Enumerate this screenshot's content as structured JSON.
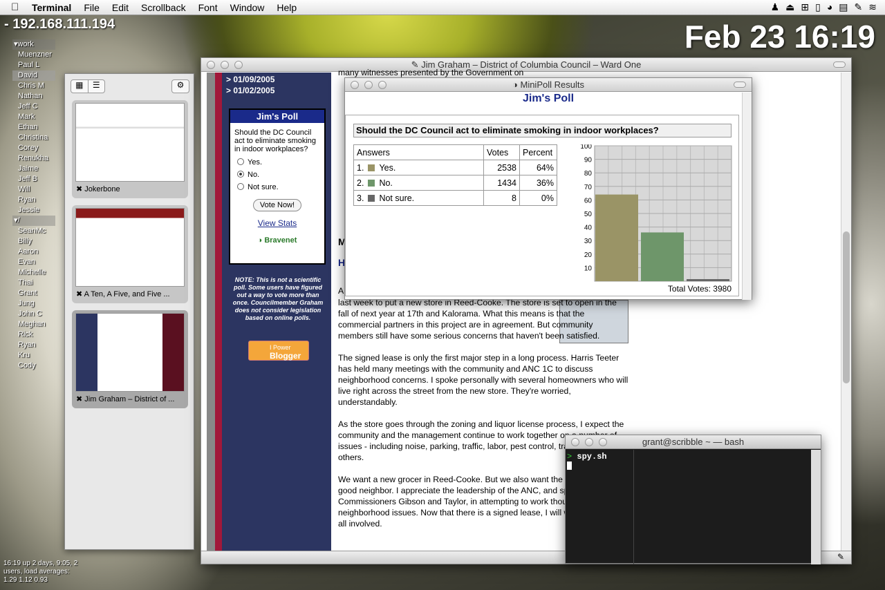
{
  "menubar": {
    "app": "Terminal",
    "items": [
      "File",
      "Edit",
      "Scrollback",
      "Font",
      "Window",
      "Help"
    ]
  },
  "desktop": {
    "ip": "- 192.168.111.194",
    "clock": "Feb 23 16:19",
    "uptime": [
      "16:19  up 2 days,  9:05, 2",
      "users, load averages:",
      "1.29 1.12 0.93"
    ]
  },
  "buddies": {
    "groups": [
      {
        "name": "▾work",
        "items": [
          "Muenzner",
          "Paul L",
          "David",
          "Chris M",
          "Nathan",
          "Jeff C",
          "Mark",
          "Ethan",
          "Christina",
          "Corey",
          "Renukha",
          "Jaime",
          "Jeff B",
          "Will",
          "Ryan",
          "Jessie"
        ]
      },
      {
        "name": "▾/",
        "items": [
          "SeanMc",
          "Billy",
          "Aaron",
          "Evan",
          "Michelle",
          "Thai",
          "Grant",
          "Jung",
          "John C",
          "Meghan",
          "Rick",
          "Ryan",
          "Kru",
          "Cody"
        ]
      }
    ]
  },
  "drawer": {
    "tabs": [
      {
        "title": "Jokerbone"
      },
      {
        "title": "A Ten, A Five, and Five ..."
      },
      {
        "title": "Jim Graham – District of ..."
      }
    ]
  },
  "browser": {
    "title": "Jim Graham – District of Columbia Council – Ward One",
    "dates": [
      "> 01/09/2005",
      "> 01/02/2005"
    ],
    "poll": {
      "title": "Jim's Poll",
      "question": "Should the DC Council act to eliminate smoking in indoor workplaces?",
      "options": [
        "Yes.",
        "No.",
        "Not sure."
      ],
      "vote": "Vote Now!",
      "stats": "View Stats",
      "brand": "Bravenet"
    },
    "note": "NOTE: This is not a scientific poll. Some users have figured out a way to vote more than once. Councilmember Graham does not consider legislation based on online polls.",
    "blogger": {
      "small": "I Power",
      "big": "Blogger"
    },
    "partial": {
      "top": "many witnesses presented by the Government on",
      "m": "M",
      "h": "H",
      "a": "A"
    },
    "article": [
      "last week to put a new store in Reed-Cooke. The store is set to open in the fall of next year at 17th and Kalorama. What this means is that the commercial partners in this project are in agreement. But community members still have some serious concerns that haven't been satisfied.",
      "The signed lease is only the first major step in a long process. Harris Teeter has held many meetings with the community and ANC 1C to discuss neighborhood concerns. I spoke personally with several homeowners who will live right across the street from the new store. They're worried, understandably.",
      "As the store goes through the zoning and liquor license process, I expect the community and the management continue to work together on a number of issues - including noise, parking, traffic, labor, pest control, trash, lighting and others.",
      "We want a new grocer in Reed-Cooke. But we also want the store to be a good neighbor. I appreciate the leadership of the ANC, and specifically Commissioners Gibson and Taylor, in attempting to work though these neighborhood issues. Now that there is a signed lease, I will work closely with all involved."
    ]
  },
  "minipoll": {
    "window_title": "MiniPoll Results",
    "title": "Jim's Poll",
    "question": "Should the DC Council act to eliminate smoking in indoor workplaces?",
    "headers": [
      "Answers",
      "Votes",
      "Percent"
    ],
    "rows": [
      {
        "num": "1.",
        "label": "Yes.",
        "votes": "2538",
        "pct": "64%",
        "color": "#9a9466"
      },
      {
        "num": "2.",
        "label": "No.",
        "votes": "1434",
        "pct": "36%",
        "color": "#6e966a"
      },
      {
        "num": "3.",
        "label": "Not sure.",
        "votes": "8",
        "pct": "0%",
        "color": "#666666"
      }
    ],
    "total": "Total Votes: 3980"
  },
  "chart_data": {
    "type": "bar",
    "categories": [
      "Yes.",
      "No.",
      "Not sure."
    ],
    "values": [
      64,
      36,
      0.2
    ],
    "ylim": [
      0,
      100
    ],
    "yticks": [
      10,
      20,
      30,
      40,
      50,
      60,
      70,
      80,
      90,
      100
    ],
    "colors": [
      "#9a9466",
      "#6e966a",
      "#666666"
    ],
    "grid": true
  },
  "terminal": {
    "title": "grant@scribble ~ — bash",
    "command": "spy.sh"
  }
}
